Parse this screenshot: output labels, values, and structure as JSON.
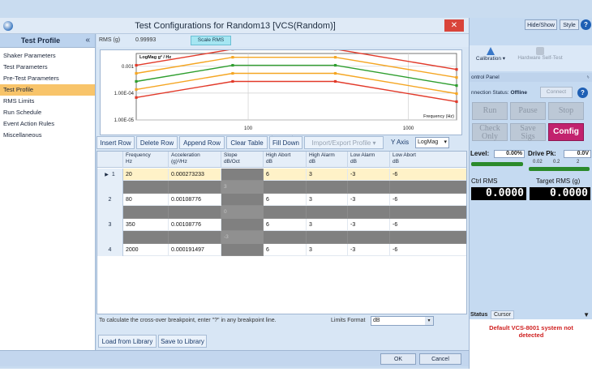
{
  "window": {
    "title": "Test Configurations for Random13 [VCS(Random)]",
    "close": "✕"
  },
  "nav": {
    "header": "Test Profile",
    "collapse": "«",
    "items": [
      {
        "label": "Shaker Parameters"
      },
      {
        "label": "Test Parameters"
      },
      {
        "label": "Pre-Test Parameters"
      },
      {
        "label": "Test Profile"
      },
      {
        "label": "RMS Limits"
      },
      {
        "label": "Run Schedule"
      },
      {
        "label": "Event Action Rules"
      },
      {
        "label": "Miscellaneous"
      }
    ],
    "active_index": 3
  },
  "rms": {
    "label": "RMS (g)",
    "value": "0.99993",
    "scale_button": "Scale RMS"
  },
  "chart_data": {
    "type": "line",
    "ylabel": "LogMag g² / Hz",
    "xlabel": "Frequency (Hz)",
    "x_scale": "log",
    "y_scale": "log",
    "xlim": [
      20,
      2000
    ],
    "ylim": [
      1e-05,
      0.003
    ],
    "x_ticks": [
      100,
      1000
    ],
    "y_ticks": [
      {
        "value": 0.001,
        "label": "0.001"
      },
      {
        "value": 0.0001,
        "label": "1.00E-04"
      },
      {
        "value": 1e-05,
        "label": "1.00E-05"
      }
    ],
    "grid": true,
    "series": [
      {
        "role": "high-abort",
        "color": "#e23a2a",
        "x": [
          20,
          80,
          350,
          2000
        ],
        "y": [
          0.00109,
          0.00434,
          0.00434,
          0.000763
        ]
      },
      {
        "role": "high-alarm",
        "color": "#f5a623",
        "x": [
          20,
          80,
          350,
          2000
        ],
        "y": [
          0.000545,
          0.00217,
          0.00217,
          0.000382
        ]
      },
      {
        "role": "profile",
        "color": "#2e9e2e",
        "x": [
          20,
          80,
          350,
          2000
        ],
        "y": [
          0.000273,
          0.00109,
          0.00109,
          0.000191
        ]
      },
      {
        "role": "low-alarm",
        "color": "#f5a623",
        "x": [
          20,
          80,
          350,
          2000
        ],
        "y": [
          0.000137,
          0.000545,
          0.000545,
          9.58e-05
        ]
      },
      {
        "role": "low-abort",
        "color": "#e23a2a",
        "x": [
          20,
          80,
          350,
          2000
        ],
        "y": [
          6.85e-05,
          0.000273,
          0.000273,
          4.8e-05
        ]
      }
    ]
  },
  "splitter": "▲ ········ ▲",
  "toolbar": {
    "insert_row": "Insert Row",
    "delete_row": "Delete Row",
    "append_row": "Append Row",
    "clear_table": "Clear Table",
    "fill_down": "Fill Down",
    "import_export": "Import/Export Profile ▾",
    "y_axis_label": "Y Axis",
    "y_axis_value": "LogMag",
    "dropdown_arrow": "▾"
  },
  "table": {
    "columns": [
      {
        "line1": "Frequency",
        "line2": "Hz"
      },
      {
        "line1": "Acceleration",
        "line2": "(g)²/Hz"
      },
      {
        "line1": "Slope",
        "line2": "dB/Oct"
      },
      {
        "line1": "High Abort",
        "line2": "dB"
      },
      {
        "line1": "High Alarm",
        "line2": "dB"
      },
      {
        "line1": "Low Alarm",
        "line2": "dB"
      },
      {
        "line1": "Low Abort",
        "line2": "dB"
      }
    ],
    "selected_marker": "▶",
    "rows": [
      {
        "num": "1",
        "freq": "20",
        "accel": "0.000273233",
        "high_abort": "6",
        "high_alarm": "3",
        "low_alarm": "-3",
        "low_abort": "-6"
      },
      {
        "num": "2",
        "freq": "80",
        "accel": "0.00108776",
        "high_abort": "6",
        "high_alarm": "3",
        "low_alarm": "-3",
        "low_abort": "-6"
      },
      {
        "num": "3",
        "freq": "350",
        "accel": "0.00108776",
        "high_abort": "6",
        "high_alarm": "3",
        "low_alarm": "-3",
        "low_abort": "-6"
      },
      {
        "num": "4",
        "freq": "2000",
        "accel": "0.000191497",
        "high_abort": "6",
        "high_alarm": "3",
        "low_alarm": "-3",
        "low_abort": "-6"
      }
    ],
    "slopes": [
      "3",
      "0",
      "-3"
    ]
  },
  "hint": "To calculate the cross-over breakpoint, enter \"?\" in any breakpoint line.",
  "limits_format": {
    "label": "Limits Format",
    "value": "dB",
    "arrow": "▾"
  },
  "library": {
    "load": "Load from Library",
    "save": "Save to Library"
  },
  "footer": {
    "ok": "OK",
    "cancel": "Cancel"
  },
  "right": {
    "hide_show": "Hide/Show",
    "style": "Style",
    "help": "?",
    "calibration": "Calibration ▾",
    "hardware_self_test": "Hardware Self-Test",
    "control_panel": "ontrol Panel",
    "pin": "ᛃ",
    "connection_label": "nnection Status:",
    "connection_value": "Offline",
    "connect": "Connect",
    "run": "Run",
    "pause": "Pause",
    "stop": "Stop",
    "check_only_1": "Check",
    "check_only_2": "Only",
    "save_sigs_1": "Save",
    "save_sigs_2": "Sigs",
    "config": "Config",
    "level_label": "Level:",
    "level_value": "0.00%",
    "level_fraction": 1.0,
    "drive_label": "Drive Pk:",
    "drive_value": "0.0V",
    "drive_scale_a": "0.02",
    "drive_scale_b": "0.2",
    "drive_scale_c": "2",
    "ctrl_rms_label": "Ctrl RMS",
    "ctrl_rms_value": "0.0000",
    "target_rms_label": "Target RMS (g)",
    "target_rms_value": "0.0000",
    "status_tab": "Status",
    "cursor_tab": "Cursor",
    "status_arrow": "▼",
    "status_message_1": "Default VCS-8001 system not",
    "status_message_2": "detected"
  }
}
